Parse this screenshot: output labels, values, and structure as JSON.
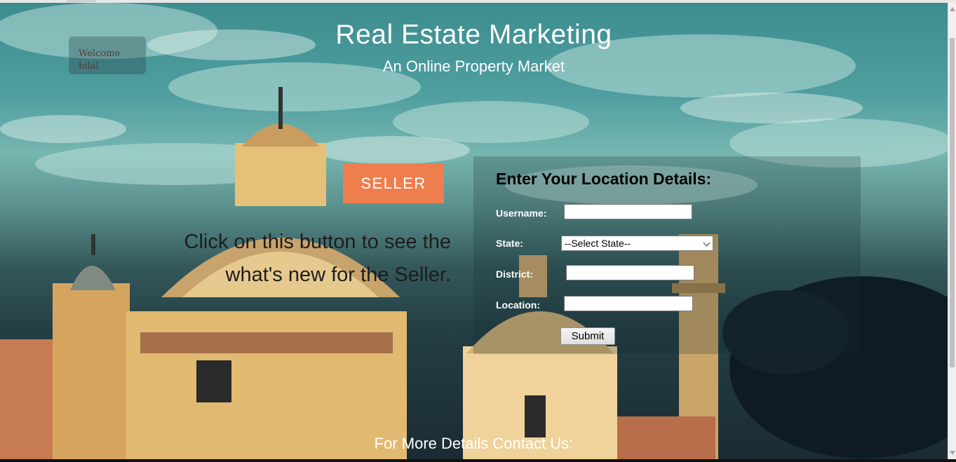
{
  "welcome": {
    "text": "Welcome bilal"
  },
  "header": {
    "title": "Real Estate Marketing",
    "subtitle": "An Online Property Market"
  },
  "seller": {
    "button_label": "SELLER",
    "description": "Click on this button to see the what's new for the Seller."
  },
  "form": {
    "title": "Enter Your Location Details:",
    "username_label": "Username:",
    "username_value": "",
    "state_label": "State:",
    "state_selected": "--Select State--",
    "district_label": "District:",
    "district_value": "",
    "location_label": "Location:",
    "location_value": "",
    "submit_label": "Submit"
  },
  "footer": {
    "text": "For More Details Contact Us:"
  },
  "colors": {
    "accent": "#ef7e4e",
    "text_light": "#ffffff",
    "form_title": "#000000"
  }
}
